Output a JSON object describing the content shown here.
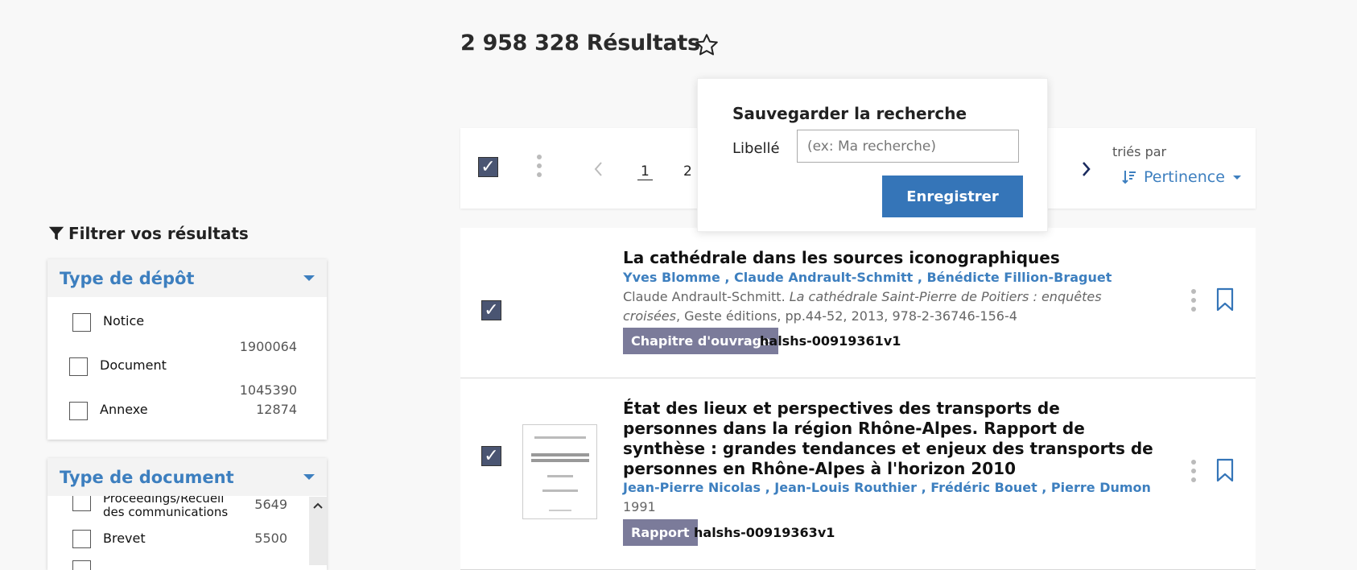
{
  "header": {
    "results_title": "2 958 328 Résultats"
  },
  "filter": {
    "heading": "Filtrer vos résultats",
    "facets": [
      {
        "title": "Type de dépôt",
        "options": [
          {
            "label": "Notice",
            "count": "1900064"
          },
          {
            "label": "Document",
            "count": "1045390"
          },
          {
            "label": "Annexe",
            "count": "12874"
          }
        ]
      },
      {
        "title": "Type de document",
        "options": [
          {
            "label": "Proceedings/Recueil des communications",
            "count": "5649"
          },
          {
            "label": "Brevet",
            "count": "5500"
          }
        ]
      }
    ]
  },
  "toolbar": {
    "pages": [
      "1",
      "2"
    ],
    "sorted_by_label": "triés par",
    "sort_value": "Pertinence"
  },
  "save_popover": {
    "title": "Sauvegarder la recherche",
    "label": "Libellé",
    "placeholder": "(ex: Ma recherche)",
    "button": "Enregistrer"
  },
  "results": [
    {
      "title": "La cathédrale dans les sources iconographiques",
      "authors": "Yves Blomme , Claude Andrault-Schmitt , Bénédicte Fillion-Braguet",
      "ref_plain": "Claude Andrault-Schmitt. ",
      "ref_italic": "La cathédrale Saint-Pierre de Poitiers : enquêtes croisées",
      "ref_rest": ", Geste éditions, pp.44-52, 2013, 978-2-36746-156-4",
      "type": "Chapitre d'ouvrage",
      "hal_id": "halshs-00919361v1"
    },
    {
      "title": "État des lieux et perspectives des transports de personnes dans la région Rhône-Alpes. Rapport de synthèse : grandes tendances et enjeux des transports de personnes en Rhône-Alpes à l'horizon 2010",
      "authors": "Jean-Pierre Nicolas , Jean-Louis Routhier , Frédéric Bouet , Pierre Dumon",
      "year": "1991",
      "type": "Rapport",
      "hal_id": "halshs-00919363v1"
    }
  ],
  "colors": {
    "accent": "#3d7fbf",
    "button": "#3575b8",
    "badge": "#7b7b9a",
    "checkbox": "#4a5572"
  }
}
